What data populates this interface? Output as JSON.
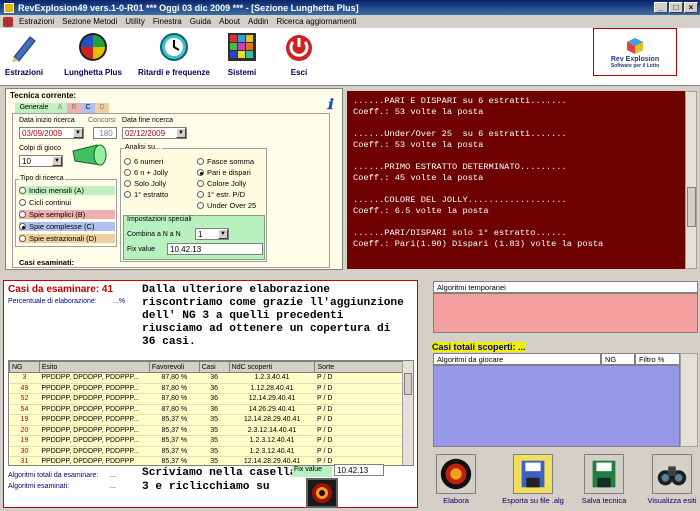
{
  "window": {
    "title": "RevExplosion49 vers.1-0-R01  ***  Oggi 03 dic 2009  ***  - [Sezione Lunghetta Plus]"
  },
  "menu": [
    "Estrazioni",
    "Sezione Metodi",
    "Utility",
    "Finestra",
    "Guida",
    "About",
    "Addin",
    "Ricerca aggiornamenti"
  ],
  "toolbar": {
    "estrazioni": "Estrazioni",
    "lunghetta": "Lunghetta Plus",
    "ritardi": "Ritardi e frequenze",
    "sistemi": "Sistemi",
    "esci": "Esci"
  },
  "logo": {
    "line1": "Rev Explosion",
    "line2": "Software per il Lotto"
  },
  "tecnica": {
    "title": "Tecnica corrente:",
    "tabs": [
      "Generale",
      "A",
      "B",
      "C",
      "D"
    ],
    "data_inizio_label": "Data inizio ricerca",
    "data_inizio": "03/09/2009",
    "concorsi_label": "Concorsi",
    "concorsi": "180",
    "data_fine_label": "Data fine ricerca",
    "data_fine": "02/12/2009",
    "colpi_label": "Colpi di gioco",
    "colpi": "10",
    "tipo_label": "Tipo di ricerca",
    "tipo": [
      "Indici mensili (A)",
      "Cicli continui",
      "Spie semplici (B)",
      "Spie complesse (C)",
      "Spie estrazionali (D)"
    ],
    "analisi_label": "Analisi su...",
    "analisi_left": [
      "6 numeri",
      "6 n + Jolly",
      "Solo Jolly",
      "1° estratto"
    ],
    "analisi_right": [
      "Fasce somma",
      "Pari e dispari",
      "Colore Jolly",
      "1° estr. P/D",
      "Under Over 25"
    ],
    "impostazioni_label": "Impostazioni speciali",
    "combina_label": "Combina a N a N",
    "combina": "1",
    "fix_label": "Fix value",
    "fix_value": "10.42.13",
    "casi_esaminati": "Casi esaminati:"
  },
  "output_lines": [
    "......PARI E DISPARI su 6 estratti.......",
    "Coeff.: 53 volte la posta",
    "",
    "......Under/Over 25  su 6 estratti.......",
    "Coeff.: 53 volte la posta",
    "",
    "......PRIMO ESTRATTO DETERMINATO.........",
    "Coeff.: 45 volte la posta",
    "",
    "......COLORE DEL JOLLY...................",
    "Coeff.: 6.5 volte la posta",
    "",
    "......PARI/DISPARI solo 1° estratto......",
    "Coeff.: Pari(1.90) Dispari (1.83) volte la posta"
  ],
  "results": {
    "casi_label": "Casi da esaminare: 41",
    "percentuale_label": "Percentuale di elaborazione:",
    "percentuale_value": "...%",
    "narrative": "Dalla ulteriore elaborazione riscontriamo come grazie ll'aggiunzione dell' NG 3 a quelli precedenti riusciamo ad ottenere un copertura di 36 casi.",
    "columns": [
      "NG",
      "Esito",
      "Favorevoli",
      "Casi",
      "NdC scoperti",
      "Sorte"
    ],
    "rows": [
      [
        "3",
        "PPDDPP, DPDDPP, PDDPPP...",
        "87,80 %",
        "36",
        "1.2.3.40.41",
        "P / D"
      ],
      [
        "49",
        "PPDDPP, DPDDPP, PDDPPP...",
        "87,80 %",
        "36",
        "1.12.28.40.41",
        "P / D"
      ],
      [
        "52",
        "PPDDPP, DPDDPP, PDDPPP...",
        "87,80 %",
        "36",
        "12.14.29.40.41",
        "P / D"
      ],
      [
        "54",
        "PPDDPP, DPDDPP, PDDPPP...",
        "87,80 %",
        "36",
        "14.26.29.40.41",
        "P / D"
      ],
      [
        "19",
        "PPDDPP, DPDDPP, PDDPPP...",
        "85,37 %",
        "35",
        "12.14.28.29.40.41",
        "P / D"
      ],
      [
        "20",
        "PPDDPP, DPDDPP, PDDPPP...",
        "85,37 %",
        "35",
        "2.3.12.14.40.41",
        "P / D"
      ],
      [
        "19",
        "PPDDPP, DPDDPP, PDDPPP...",
        "85,37 %",
        "35",
        "1.2.3.12.40.41",
        "P / D"
      ],
      [
        "30",
        "PPDDPP, DPDDPP, PDDPPP...",
        "85,37 %",
        "35",
        "1.2.3.12.40.41",
        "P / D"
      ],
      [
        "31",
        "PPDDPP, DPDDPP, PDDPPP",
        "85,37 %",
        "35",
        "12.14.28.29.40.41",
        "P / D"
      ]
    ],
    "algoritmi_totali": "Algoritmi totali da esaminare:",
    "algoritmi_totali_value": "...",
    "algoritmi_esaminati": "Algoritmi esaminati:",
    "algoritmi_esaminati_value": "...",
    "bottom_narrative": "Scriviamo nella casella l'NG 3 e riclicchiamo su",
    "fix_label": "Fix value",
    "fix_value": "10.42.13"
  },
  "right": {
    "algoritmi_temporanei": "Algoritmi temporanei",
    "casi_totali": "Casi totali scoperti: ...",
    "columns": [
      "Algoritmi da giocare",
      "NG",
      "Filtro %"
    ],
    "buttons": [
      "Elabora",
      "Esporta su file .alg",
      "Salva tecnica",
      "Visualizza esiti"
    ]
  }
}
